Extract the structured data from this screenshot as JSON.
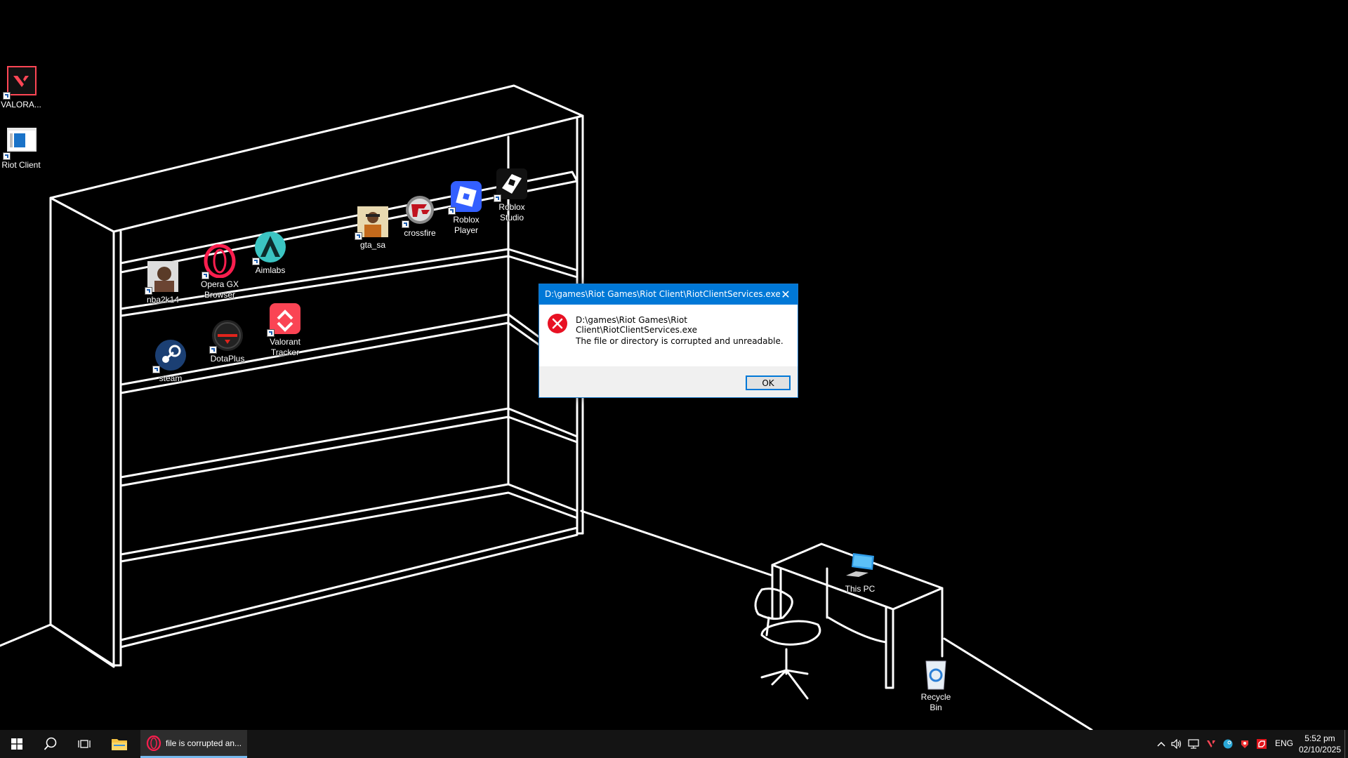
{
  "desktop": {
    "icons": [
      {
        "label": "VALORA..."
      },
      {
        "label": "Riot Client"
      },
      {
        "label": "Roblox\nStudio"
      },
      {
        "label": "Roblox\nPlayer"
      },
      {
        "label": "crossfire"
      },
      {
        "label": "gta_sa"
      },
      {
        "label": "Aimlabs"
      },
      {
        "label": "Opera GX\nBrowser"
      },
      {
        "label": "nba2k14"
      },
      {
        "label": "Valorant\nTracker"
      },
      {
        "label": "DotaPlus"
      },
      {
        "label": "steam"
      },
      {
        "label": "This PC"
      },
      {
        "label": "Recycle\nBin"
      }
    ]
  },
  "dialog": {
    "title": "D:\\games\\Riot Games\\Riot Client\\RiotClientServices.exe",
    "path": "D:\\games\\Riot Games\\Riot Client\\RiotClientServices.exe",
    "message": "The file or directory is corrupted and unreadable.",
    "ok_label": "OK",
    "close_glyph": "✕"
  },
  "taskbar": {
    "active_window_label": "file is corrupted an...",
    "language": "ENG",
    "time": "5:52 pm",
    "date": "02/10/2025"
  },
  "colors": {
    "accent": "#0078d7",
    "error": "#e81123",
    "taskbar": "#141414"
  }
}
